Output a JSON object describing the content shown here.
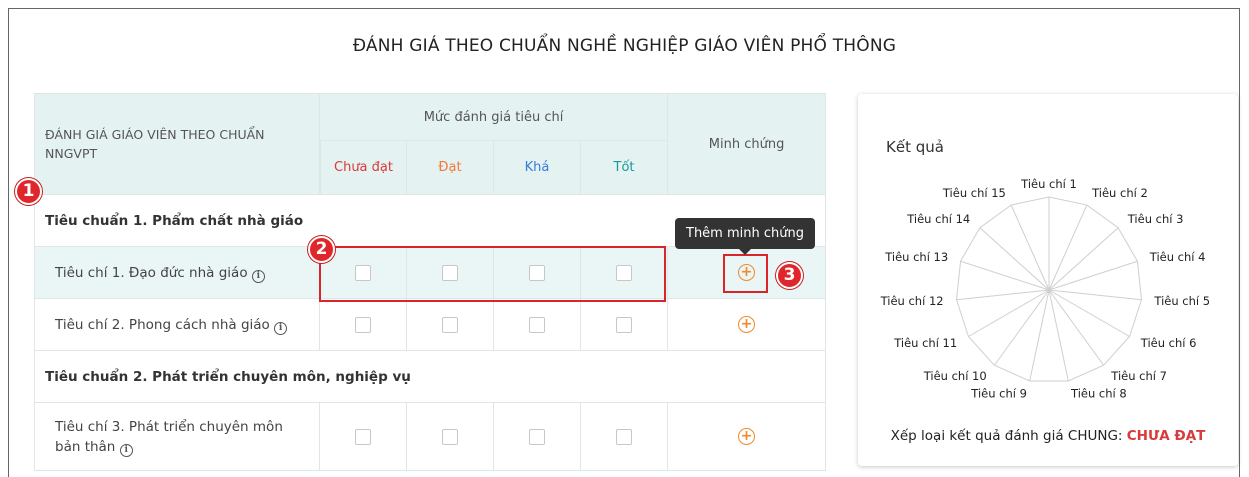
{
  "page": {
    "title": "ĐÁNH GIÁ THEO CHUẨN NGHỀ NGHIỆP GIÁO VIÊN PHỔ THÔNG"
  },
  "table": {
    "header_main": "ĐÁNH GIÁ GIÁO VIÊN THEO CHUẨN NNGVPT",
    "header_group": "Mức đánh giá tiêu chí",
    "header_evidence": "Minh chứng",
    "levels": [
      {
        "label": "Chưa đạt",
        "color": "#d93a3a"
      },
      {
        "label": "Đạt",
        "color": "#f07a3c"
      },
      {
        "label": "Khá",
        "color": "#3a7ad9"
      },
      {
        "label": "Tốt",
        "color": "#1a9a9a"
      }
    ],
    "rows": [
      {
        "type": "standard",
        "label": "Tiêu chuẩn 1. Phẩm chất nhà giáo"
      },
      {
        "type": "criterion",
        "label": "Tiêu chí 1. Đạo đức nhà giáo",
        "highlighted": true
      },
      {
        "type": "criterion",
        "label": "Tiêu chí 2. Phong cách nhà giáo"
      },
      {
        "type": "standard",
        "label": "Tiêu chuẩn 2. Phát triển chuyên môn, nghiệp vụ"
      },
      {
        "type": "criterion",
        "label": "Tiêu chí 3. Phát triển chuyên môn bản thân"
      }
    ]
  },
  "tooltip": {
    "text": "Thêm minh chứng"
  },
  "badges": [
    "1",
    "2",
    "3"
  ],
  "result": {
    "title": "Kết quả",
    "axes": [
      "Tiêu chí 1",
      "Tiêu chí 2",
      "Tiêu chí 3",
      "Tiêu chí 4",
      "Tiêu chí 5",
      "Tiêu chí 6",
      "Tiêu chí 7",
      "Tiêu chí 8",
      "Tiêu chí 9",
      "Tiêu chí 10",
      "Tiêu chí 11",
      "Tiêu chí 12",
      "Tiêu chí 13",
      "Tiêu chí 14",
      "Tiêu chí 15"
    ],
    "rank_label": "Xếp loại kết quả đánh giá CHUNG:",
    "rank_value": "CHƯA ĐẠT"
  },
  "colors": {
    "accent": "#f08a2c",
    "danger": "#d9252a",
    "header_bg": "#e5f2f2"
  }
}
